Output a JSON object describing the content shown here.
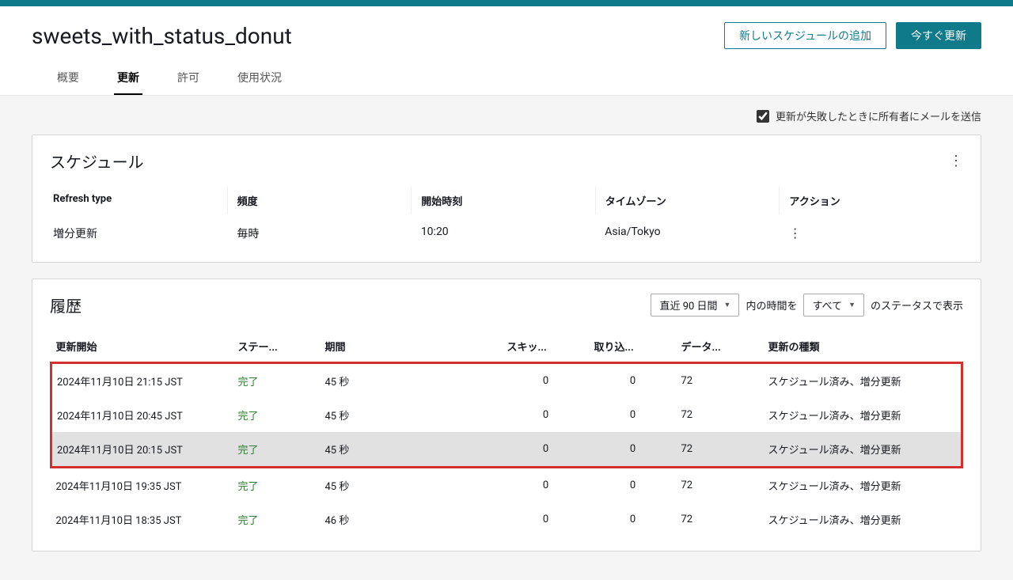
{
  "header": {
    "title": "sweets_with_status_donut",
    "add_schedule_label": "新しいスケジュールの追加",
    "refresh_now_label": "今すぐ更新"
  },
  "tabs": {
    "overview": "概要",
    "refresh": "更新",
    "permission": "許可",
    "usage": "使用状況"
  },
  "email_opt": {
    "label": "更新が失敗したときに所有者にメールを送信"
  },
  "schedule": {
    "title": "スケジュール",
    "headers": {
      "type": "Refresh type",
      "frequency": "頻度",
      "start": "開始時刻",
      "timezone": "タイムゾーン",
      "action": "アクション"
    },
    "row": {
      "type": "増分更新",
      "frequency": "毎時",
      "start": "10:20",
      "timezone": "Asia/Tokyo"
    }
  },
  "history": {
    "title": "履歴",
    "recent_label": "直近 90 日間",
    "mid_text": "内の時間を",
    "status_label": "すべて",
    "tail_text": "のステータスで表示",
    "headers": {
      "start": "更新開始",
      "status": "ステー...",
      "duration": "期間",
      "skipped": "スキッ...",
      "imported": "取り込...",
      "data": "データ...",
      "type": "更新の種類"
    },
    "rows": [
      {
        "start": "2024年11月10日 21:15 JST",
        "status": "完了",
        "duration": "45 秒",
        "skipped": "0",
        "imported": "0",
        "data": "72",
        "type": "スケジュール済み、増分更新"
      },
      {
        "start": "2024年11月10日 20:45 JST",
        "status": "完了",
        "duration": "45 秒",
        "skipped": "0",
        "imported": "0",
        "data": "72",
        "type": "スケジュール済み、増分更新"
      },
      {
        "start": "2024年11月10日 20:15 JST",
        "status": "完了",
        "duration": "45 秒",
        "skipped": "0",
        "imported": "0",
        "data": "72",
        "type": "スケジュール済み、増分更新"
      },
      {
        "start": "2024年11月10日 19:35 JST",
        "status": "完了",
        "duration": "45 秒",
        "skipped": "0",
        "imported": "0",
        "data": "72",
        "type": "スケジュール済み、増分更新"
      },
      {
        "start": "2024年11月10日 18:35 JST",
        "status": "完了",
        "duration": "46 秒",
        "skipped": "0",
        "imported": "0",
        "data": "72",
        "type": "スケジュール済み、増分更新"
      }
    ]
  }
}
